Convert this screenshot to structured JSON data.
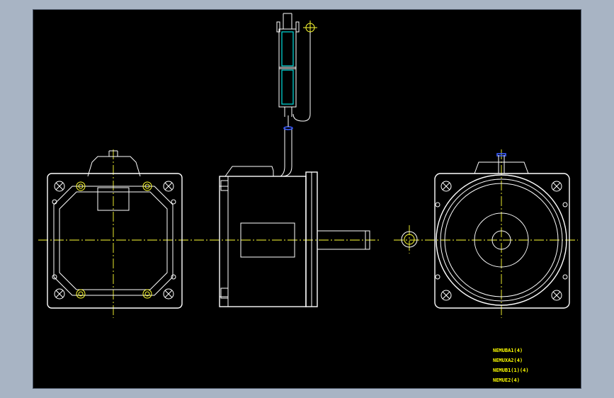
{
  "drawing": {
    "line_color": "#ffffff",
    "center_line_color": "#ffff33",
    "cable_color": "#00e0e0",
    "background": "#000000",
    "frame_background": "#a8b4c4"
  },
  "labels": [
    "NEMUBA1(4)",
    "NEMUXA2(4)",
    "NEMUB1(1)(4)",
    "NEMUE2(4)"
  ]
}
